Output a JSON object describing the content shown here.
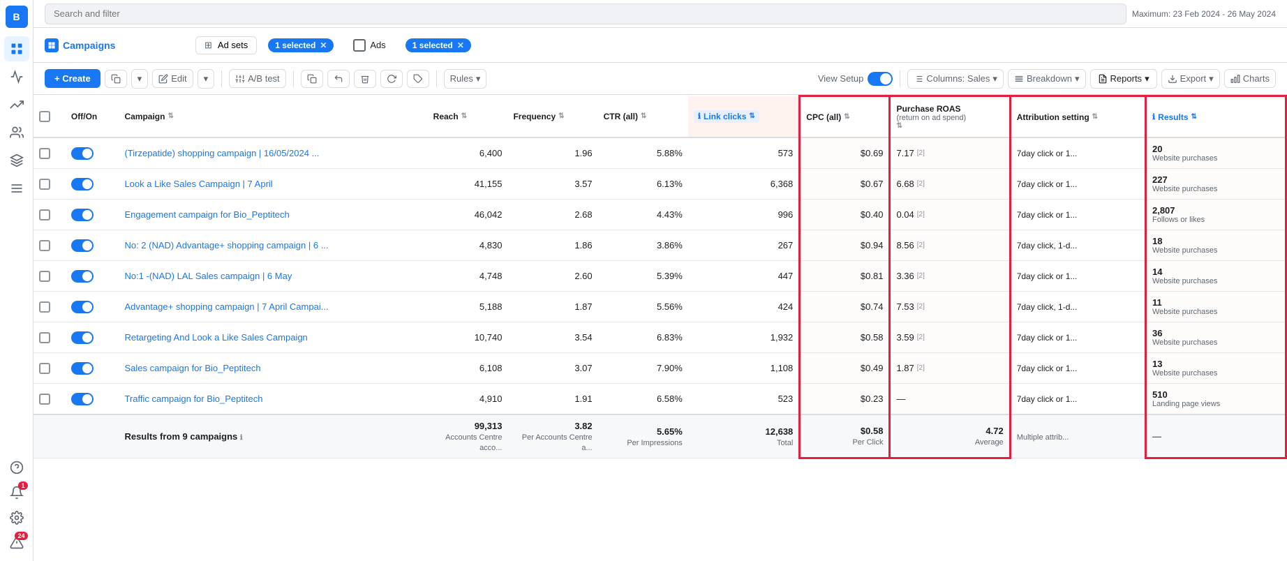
{
  "app": {
    "avatar": "B",
    "search_placeholder": "Search and filter",
    "date_range": "Maximum: 23 Feb 2024 - 26 May 2024"
  },
  "nav": {
    "campaign_title": "Campaigns",
    "ad_sets_label": "Ad sets",
    "ads_label": "Ads",
    "selected_1": "1 selected",
    "selected_2": "1 selected"
  },
  "toolbar": {
    "create_label": "+ Create",
    "edit_label": "Edit",
    "ab_test_label": "A/B test",
    "rules_label": "Rules",
    "view_setup_label": "View Setup",
    "columns_label": "Columns: Sales",
    "breakdown_label": "Breakdown",
    "reports_label": "Reports",
    "export_label": "Export",
    "charts_label": "Charts"
  },
  "table": {
    "headers": [
      {
        "id": "offon",
        "label": "Off/On"
      },
      {
        "id": "campaign",
        "label": "Campaign"
      },
      {
        "id": "reach",
        "label": "Reach"
      },
      {
        "id": "frequency",
        "label": "Frequency"
      },
      {
        "id": "ctr",
        "label": "CTR (all)"
      },
      {
        "id": "linkclicks",
        "label": "Link clicks"
      },
      {
        "id": "cpc",
        "label": "CPC (all)"
      },
      {
        "id": "roas",
        "label": "Purchase ROAS (return on ad spend)"
      },
      {
        "id": "attribution",
        "label": "Attribution setting"
      },
      {
        "id": "results",
        "label": "Results"
      }
    ],
    "rows": [
      {
        "name": "(Tirzepatide) shopping campaign | 16/05/2024 ...",
        "reach": "6,400",
        "frequency": "1.96",
        "ctr": "5.88%",
        "linkclicks": "573",
        "cpc": "$0.69",
        "roas": "7.17",
        "roas_info": "2",
        "attribution": "7day click or 1...",
        "results_val": "20",
        "results_sub": "Website purchases"
      },
      {
        "name": "Look a Like Sales Campaign | 7 April",
        "reach": "41,155",
        "frequency": "3.57",
        "ctr": "6.13%",
        "linkclicks": "6,368",
        "cpc": "$0.67",
        "roas": "6.68",
        "roas_info": "2",
        "attribution": "7day click or 1...",
        "results_val": "227",
        "results_sub": "Website purchases"
      },
      {
        "name": "Engagement campaign for Bio_Peptitech",
        "reach": "46,042",
        "frequency": "2.68",
        "ctr": "4.43%",
        "linkclicks": "996",
        "cpc": "$0.40",
        "roas": "0.04",
        "roas_info": "2",
        "attribution": "7day click or 1...",
        "results_val": "2,807",
        "results_sub": "Follows or likes"
      },
      {
        "name": "No: 2 (NAD) Advantage+ shopping campaign | 6 ...",
        "reach": "4,830",
        "frequency": "1.86",
        "ctr": "3.86%",
        "linkclicks": "267",
        "cpc": "$0.94",
        "roas": "8.56",
        "roas_info": "2",
        "attribution": "7day click, 1-d...",
        "results_val": "18",
        "results_sub": "Website purchases"
      },
      {
        "name": "No:1 -(NAD) LAL Sales campaign | 6 May",
        "reach": "4,748",
        "frequency": "2.60",
        "ctr": "5.39%",
        "linkclicks": "447",
        "cpc": "$0.81",
        "roas": "3.36",
        "roas_info": "2",
        "attribution": "7day click or 1...",
        "results_val": "14",
        "results_sub": "Website purchases"
      },
      {
        "name": "Advantage+ shopping campaign | 7 April Campai...",
        "reach": "5,188",
        "frequency": "1.87",
        "ctr": "5.56%",
        "linkclicks": "424",
        "cpc": "$0.74",
        "roas": "7.53",
        "roas_info": "2",
        "attribution": "7day click, 1-d...",
        "results_val": "11",
        "results_sub": "Website purchases"
      },
      {
        "name": "Retargeting And Look a Like Sales Campaign",
        "reach": "10,740",
        "frequency": "3.54",
        "ctr": "6.83%",
        "linkclicks": "1,932",
        "cpc": "$0.58",
        "roas": "3.59",
        "roas_info": "2",
        "attribution": "7day click or 1...",
        "results_val": "36",
        "results_sub": "Website purchases"
      },
      {
        "name": "Sales campaign for Bio_Peptitech",
        "reach": "6,108",
        "frequency": "3.07",
        "ctr": "7.90%",
        "linkclicks": "1,108",
        "cpc": "$0.49",
        "roas": "1.87",
        "roas_info": "2",
        "attribution": "7day click or 1...",
        "results_val": "13",
        "results_sub": "Website purchases"
      },
      {
        "name": "Traffic campaign for Bio_Peptitech",
        "reach": "4,910",
        "frequency": "1.91",
        "ctr": "6.58%",
        "linkclicks": "523",
        "cpc": "$0.23",
        "roas": "—",
        "roas_info": "",
        "attribution": "7day click or 1...",
        "results_val": "510",
        "results_sub": "Landing page views"
      }
    ],
    "footer": {
      "label": "Results from 9 campaigns",
      "reach": "99,313",
      "reach_sub": "Accounts Centre acco...",
      "frequency": "3.82",
      "frequency_sub": "Per Accounts Centre a...",
      "ctr": "5.65%",
      "ctr_sub": "Per Impressions",
      "linkclicks": "12,638",
      "linkclicks_sub": "Total",
      "cpc": "$0.58",
      "cpc_sub": "Per Click",
      "roas": "4.72",
      "roas_sub": "Average",
      "attribution": "Multiple attrib...",
      "results": "—"
    }
  },
  "sidebar": {
    "icons": [
      {
        "name": "grid-icon",
        "label": "Grid",
        "active": true
      },
      {
        "name": "activity-icon",
        "label": "Activity"
      },
      {
        "name": "chart-icon",
        "label": "Chart"
      },
      {
        "name": "people-icon",
        "label": "People"
      },
      {
        "name": "layers-icon",
        "label": "Layers"
      },
      {
        "name": "menu-icon",
        "label": "Menu"
      },
      {
        "name": "help-icon",
        "label": "Help"
      },
      {
        "name": "notification-icon",
        "label": "Notifications",
        "badge": "1"
      },
      {
        "name": "settings-icon",
        "label": "Settings"
      },
      {
        "name": "warning-icon",
        "label": "Warning",
        "badge": "24"
      }
    ]
  }
}
